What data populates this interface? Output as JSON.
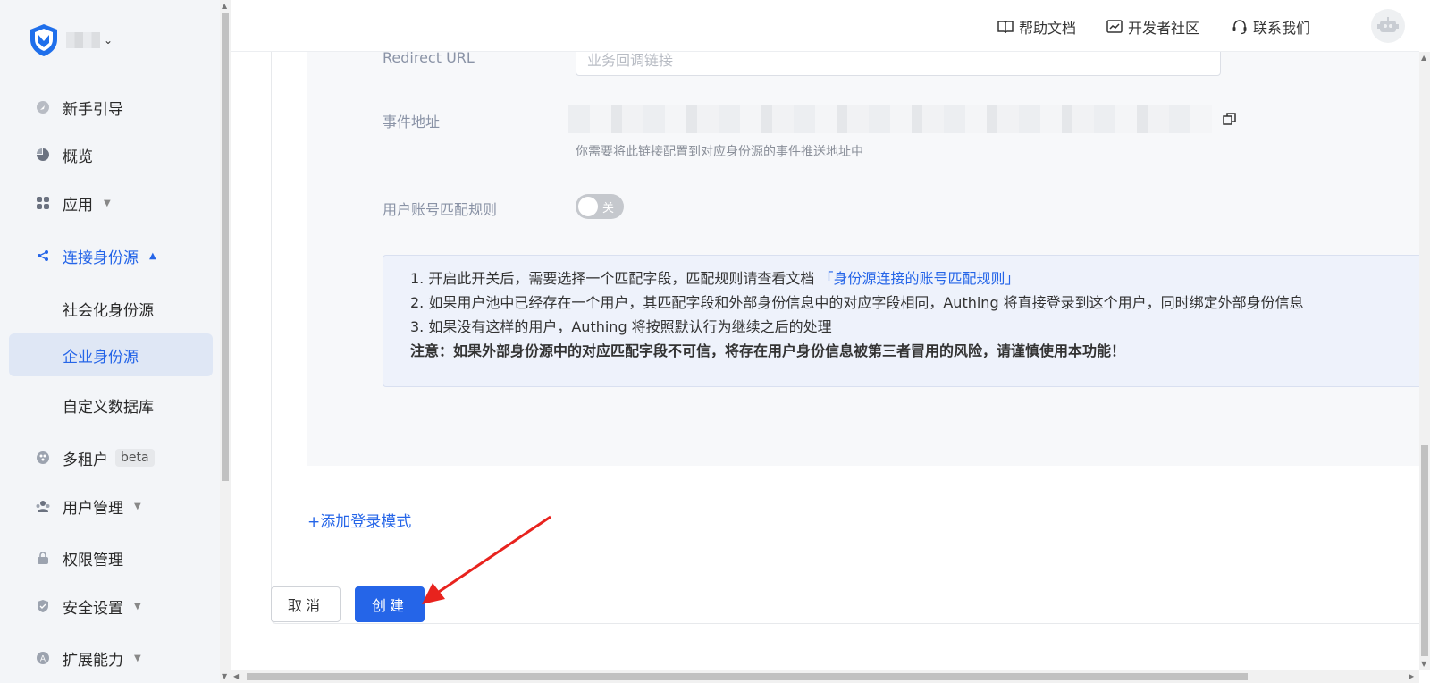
{
  "sidebar": {
    "items": [
      {
        "label": "新手引导",
        "icon": "compass-icon"
      },
      {
        "label": "概览",
        "icon": "pie-chart-icon"
      },
      {
        "label": "应用",
        "icon": "apps-icon"
      },
      {
        "label": "连接身份源",
        "icon": "share-nodes-icon"
      },
      {
        "label": "社会化身份源"
      },
      {
        "label": "企业身份源"
      },
      {
        "label": "自定义数据库"
      },
      {
        "label": "多租户",
        "icon": "tenant-icon",
        "badge": "beta"
      },
      {
        "label": "用户管理",
        "icon": "users-icon"
      },
      {
        "label": "权限管理",
        "icon": "lock-icon"
      },
      {
        "label": "安全设置",
        "icon": "shield-icon"
      },
      {
        "label": "扩展能力",
        "icon": "extension-icon"
      }
    ]
  },
  "header": {
    "help_docs": "帮助文档",
    "dev_community": "开发者社区",
    "contact_us": "联系我们"
  },
  "form": {
    "redirect_label": "Redirect URL",
    "redirect_placeholder": "业务回调链接",
    "event_label": "事件地址",
    "event_hint": "你需要将此链接配置到对应身份源的事件推送地址中",
    "match_rule_label": "用户账号匹配规则",
    "toggle_text": "关",
    "info_line1_prefix": "1. 开启此开关后，需要选择一个匹配字段，匹配规则请查看文档",
    "info_line1_link": "「身份源连接的账号匹配规则」",
    "info_line2": "2. 如果用户池中已经存在一个用户，其匹配字段和外部身份信息中的对应字段相同，Authing 将直接登录到这个用户，同时绑定外部身份信息",
    "info_line3": "3. 如果没有这样的用户，Authing 将按照默认行为继续之后的处理",
    "info_warning": "注意：如果外部身份源中的对应匹配字段不可信，将存在用户身份信息被第三者冒用的风险，请谨慎使用本功能！",
    "add_login_mode": "+添加登录模式"
  },
  "actions": {
    "cancel": "取消",
    "create": "创建"
  },
  "colors": {
    "accent": "#2565e8",
    "annotation_arrow": "#e8231e"
  }
}
